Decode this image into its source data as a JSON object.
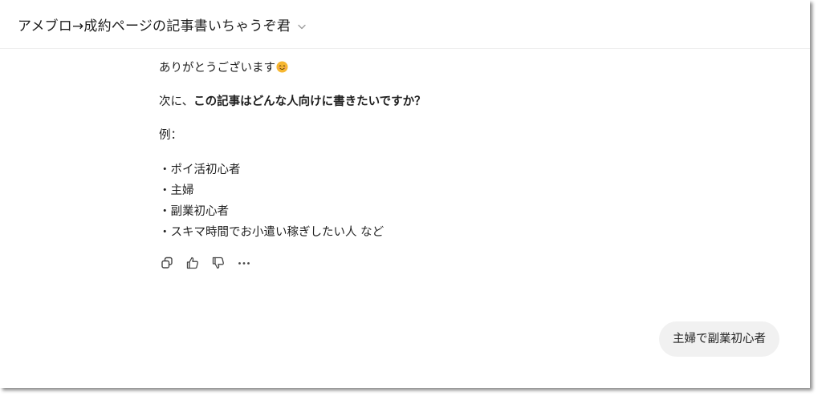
{
  "header": {
    "title": "アメブロ→成約ページの記事書いちゃうぞ君"
  },
  "assistant_message": {
    "thanks": "ありがとうございます",
    "question_prefix": "次に、",
    "question_bold": "この記事はどんな人向けに書きたいですか？",
    "example_label": "例：",
    "examples": [
      "・ポイ活初心者",
      "・主婦",
      "・副業初心者",
      "・スキマ時間でお小遣い稼ぎしたい人 など"
    ]
  },
  "actions": {
    "icons": [
      "copy-icon",
      "thumbs-up-icon",
      "thumbs-down-icon",
      "more-icon"
    ]
  },
  "user_message": {
    "text": "主婦で副業初心者"
  },
  "colors": {
    "user_bubble_bg": "#f1f1f1",
    "emoji_face": "#f7b731"
  }
}
